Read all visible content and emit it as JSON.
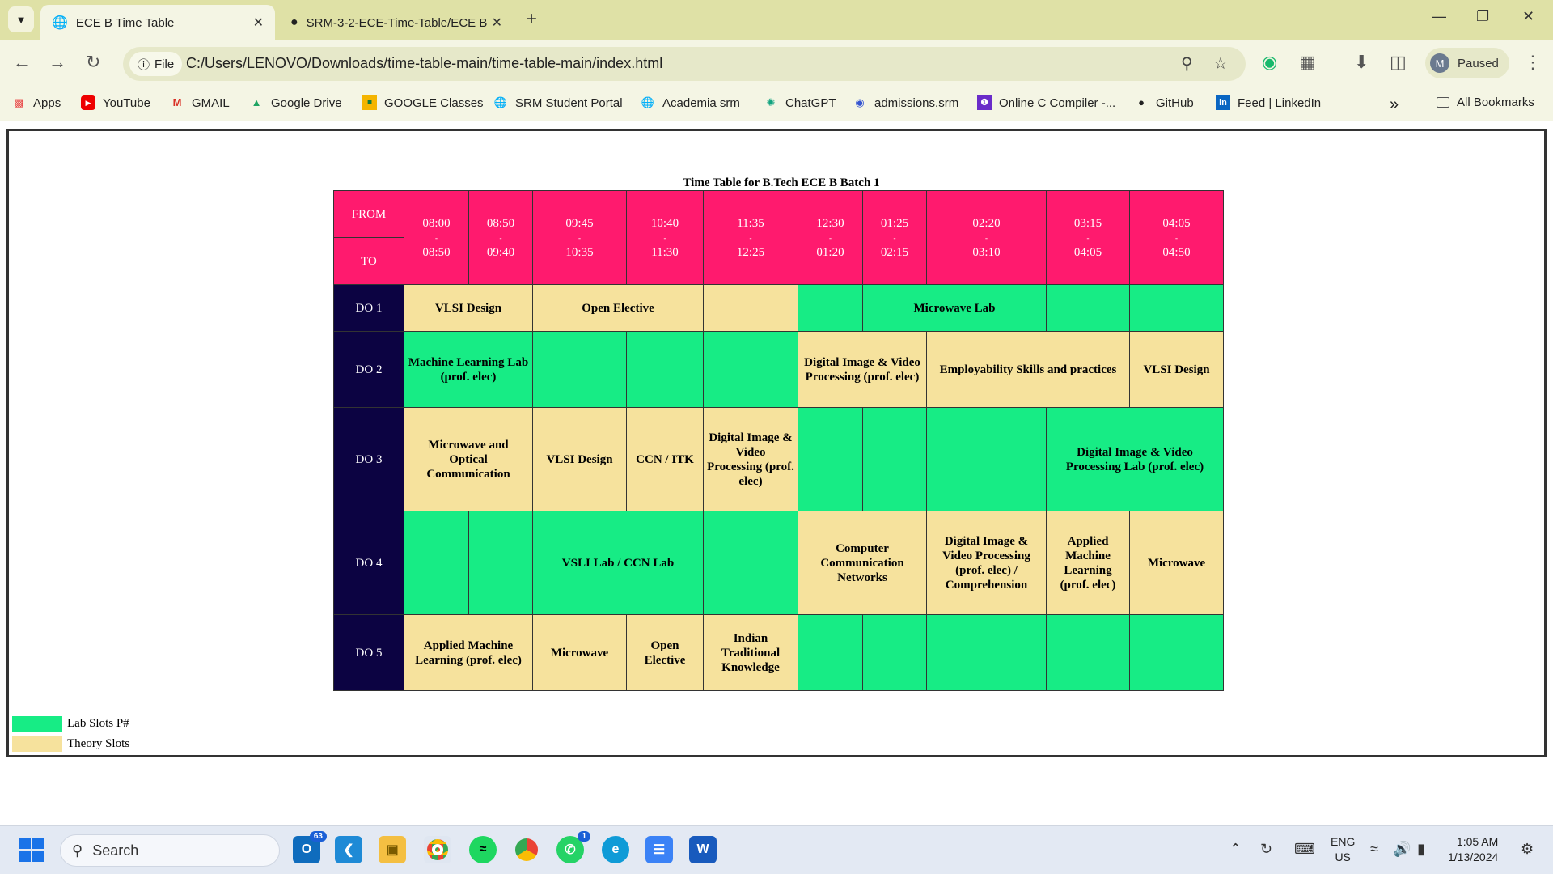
{
  "browser": {
    "tabs": [
      {
        "title": "ECE B Time Table",
        "icon": "globe-icon",
        "active": true
      },
      {
        "title": "SRM-3-2-ECE-Time-Table/ECE B",
        "icon": "github-icon",
        "active": false
      }
    ],
    "site_chip": "File",
    "url": "C:/Users/LENOVO/Downloads/time-table-main/time-table-main/index.html",
    "profile_initial": "M",
    "profile_status": "Paused"
  },
  "bookmarks": [
    {
      "label": "Apps",
      "icon": "apps-grid-icon"
    },
    {
      "label": "YouTube",
      "icon": "youtube-icon"
    },
    {
      "label": "GMAIL",
      "icon": "gmail-icon"
    },
    {
      "label": "Google Drive",
      "icon": "drive-icon"
    },
    {
      "label": "GOOGLE Classes",
      "icon": "classroom-icon"
    },
    {
      "label": "SRM Student Portal",
      "icon": "globe-icon"
    },
    {
      "label": "Academia srm",
      "icon": "globe-icon"
    },
    {
      "label": "ChatGPT",
      "icon": "chatgpt-icon"
    },
    {
      "label": "admissions.srm",
      "icon": "globe-icon"
    },
    {
      "label": "Online C Compiler -...",
      "icon": "compiler-icon"
    },
    {
      "label": "GitHub",
      "icon": "github-icon"
    },
    {
      "label": "Feed | LinkedIn",
      "icon": "linkedin-icon"
    }
  ],
  "all_bookmarks": "All Bookmarks",
  "timetable": {
    "title": "Time Table for B.Tech ECE B Batch 1",
    "from_label": "FROM",
    "to_label": "TO",
    "dash": "-",
    "slots": [
      {
        "from": "08:00",
        "to": "08:50"
      },
      {
        "from": "08:50",
        "to": "09:40"
      },
      {
        "from": "09:45",
        "to": "10:35"
      },
      {
        "from": "10:40",
        "to": "11:30"
      },
      {
        "from": "11:35",
        "to": "12:25"
      },
      {
        "from": "12:30",
        "to": "01:20"
      },
      {
        "from": "01:25",
        "to": "02:15"
      },
      {
        "from": "02:20",
        "to": "03:10"
      },
      {
        "from": "03:15",
        "to": "04:05"
      },
      {
        "from": "04:05",
        "to": "04:50"
      }
    ],
    "days": [
      {
        "label": "DO 1",
        "cells": [
          {
            "text": "VLSI Design",
            "type": "T",
            "span": 2
          },
          {
            "text": "Open Elective",
            "type": "T",
            "span": 2
          },
          {
            "text": "",
            "type": "T",
            "span": 1
          },
          {
            "text": "",
            "type": "L",
            "span": 1
          },
          {
            "text": "Microwave Lab",
            "type": "L",
            "span": 2
          },
          {
            "text": "",
            "type": "L",
            "span": 1
          },
          {
            "text": "",
            "type": "L",
            "span": 1
          }
        ]
      },
      {
        "label": "DO 2",
        "cells": [
          {
            "text": "Machine Learning Lab (prof. elec)",
            "type": "L",
            "span": 2
          },
          {
            "text": "",
            "type": "L",
            "span": 1
          },
          {
            "text": "",
            "type": "L",
            "span": 1
          },
          {
            "text": "",
            "type": "L",
            "span": 1
          },
          {
            "text": "Digital Image & Video Processing (prof. elec)",
            "type": "T",
            "span": 2
          },
          {
            "text": "Employability Skills and practices",
            "type": "T",
            "span": 2
          },
          {
            "text": "VLSI Design",
            "type": "T",
            "span": 1
          }
        ]
      },
      {
        "label": "DO 3",
        "cells": [
          {
            "text": "Microwave and Optical Communication",
            "type": "T",
            "span": 2
          },
          {
            "text": "VLSI Design",
            "type": "T",
            "span": 1
          },
          {
            "text": "CCN / ITK",
            "type": "T",
            "span": 1
          },
          {
            "text": "Digital Image & Video Processing (prof. elec)",
            "type": "T",
            "span": 1
          },
          {
            "text": "",
            "type": "L",
            "span": 1
          },
          {
            "text": "",
            "type": "L",
            "span": 1
          },
          {
            "text": "",
            "type": "L",
            "span": 1
          },
          {
            "text": "Digital Image & Video Processing Lab (prof. elec)",
            "type": "L",
            "span": 2
          }
        ]
      },
      {
        "label": "DO 4",
        "cells": [
          {
            "text": "",
            "type": "L",
            "span": 1
          },
          {
            "text": "",
            "type": "L",
            "span": 1
          },
          {
            "text": "VSLI Lab / CCN Lab",
            "type": "L",
            "span": 2
          },
          {
            "text": "",
            "type": "L",
            "span": 1
          },
          {
            "text": "Computer Communication Networks",
            "type": "T",
            "span": 2
          },
          {
            "text": "Digital Image & Video Processing (prof. elec) / Comprehension",
            "type": "T",
            "span": 1
          },
          {
            "text": "Applied Machine Learning (prof. elec)",
            "type": "T",
            "span": 1
          },
          {
            "text": "Microwave",
            "type": "T",
            "span": 1
          }
        ]
      },
      {
        "label": "DO 5",
        "cells": [
          {
            "text": "Applied Machine Learning (prof. elec)",
            "type": "T",
            "span": 2
          },
          {
            "text": "Microwave",
            "type": "T",
            "span": 1
          },
          {
            "text": "Open Elective",
            "type": "T",
            "span": 1
          },
          {
            "text": "Indian Traditional Knowledge",
            "type": "T",
            "span": 1
          },
          {
            "text": "",
            "type": "L",
            "span": 1
          },
          {
            "text": "",
            "type": "L",
            "span": 1
          },
          {
            "text": "",
            "type": "L",
            "span": 1
          },
          {
            "text": "",
            "type": "L",
            "span": 1
          },
          {
            "text": "",
            "type": "L",
            "span": 1
          }
        ]
      }
    ],
    "legend": [
      {
        "label": "Lab Slots P#",
        "color": "#17ec85"
      },
      {
        "label": "Theory Slots",
        "color": "#f6e29d"
      }
    ]
  },
  "colors": {
    "header": "#ff1a6e",
    "day": "#0c0342",
    "lab": "#17ec85",
    "theory": "#f6e29d"
  },
  "taskbar": {
    "search_placeholder": "Search",
    "outlook_badge": "63",
    "whatsapp_badge": "1",
    "lang_line1": "ENG",
    "lang_line2": "US",
    "time": "1:05 AM",
    "date": "1/13/2024"
  }
}
